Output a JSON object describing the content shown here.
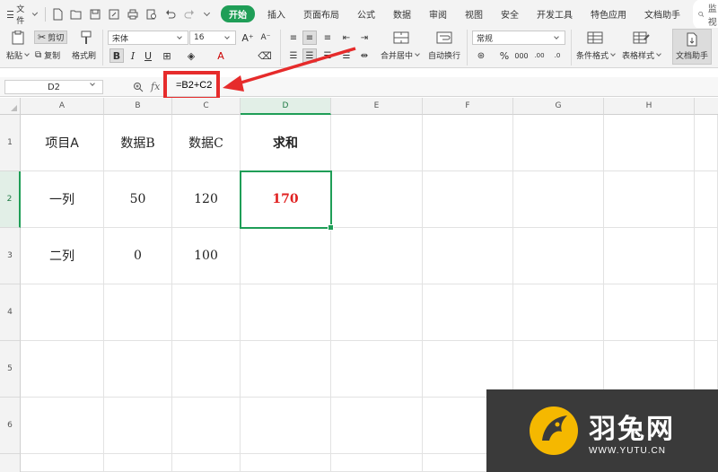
{
  "menubar": {
    "file_label": "文件",
    "tabs": [
      {
        "label": "开始",
        "active": true
      },
      {
        "label": "插入"
      },
      {
        "label": "页面布局"
      },
      {
        "label": "公式"
      },
      {
        "label": "数据"
      },
      {
        "label": "审阅"
      },
      {
        "label": "视图"
      },
      {
        "label": "安全"
      },
      {
        "label": "开发工具"
      },
      {
        "label": "特色应用"
      },
      {
        "label": "文档助手"
      }
    ],
    "search_label": "监视"
  },
  "ribbon": {
    "paste_label": "粘贴",
    "cut_label": "剪切",
    "copy_label": "复制",
    "format_painter_label": "格式刷",
    "font_name": "宋体",
    "font_size": "16",
    "bold": "B",
    "italic": "I",
    "underline": "U",
    "merge_center_label": "合并居中",
    "wrap_text_label": "自动换行",
    "number_format": "常规",
    "percent": "%",
    "conditional_format_label": "条件格式",
    "table_style_label": "表格样式",
    "doc_assistant_label": "文档助手"
  },
  "formula_bar": {
    "cell_ref": "D2",
    "fx": "fx",
    "formula": "=B2+C2"
  },
  "grid": {
    "columns": [
      "A",
      "B",
      "C",
      "D",
      "E",
      "F",
      "G",
      "H"
    ],
    "rows": [
      "1",
      "2",
      "3",
      "4",
      "5",
      "6"
    ],
    "selected_column": "D",
    "selected_row": "2",
    "cells": {
      "A1": "项目A",
      "B1": "数据B",
      "C1": "数据C",
      "D1": "求和",
      "A2": "一列",
      "B2": "50",
      "C2": "120",
      "D2": "170",
      "A3": "二列",
      "B3": "0",
      "C3": "100"
    }
  },
  "watermark": {
    "brand": "羽兔网",
    "url": "WWW.YUTU.CN"
  },
  "colors": {
    "accent": "#1f9e57",
    "highlight_red": "#e62b2b",
    "result_red": "#e02020"
  }
}
